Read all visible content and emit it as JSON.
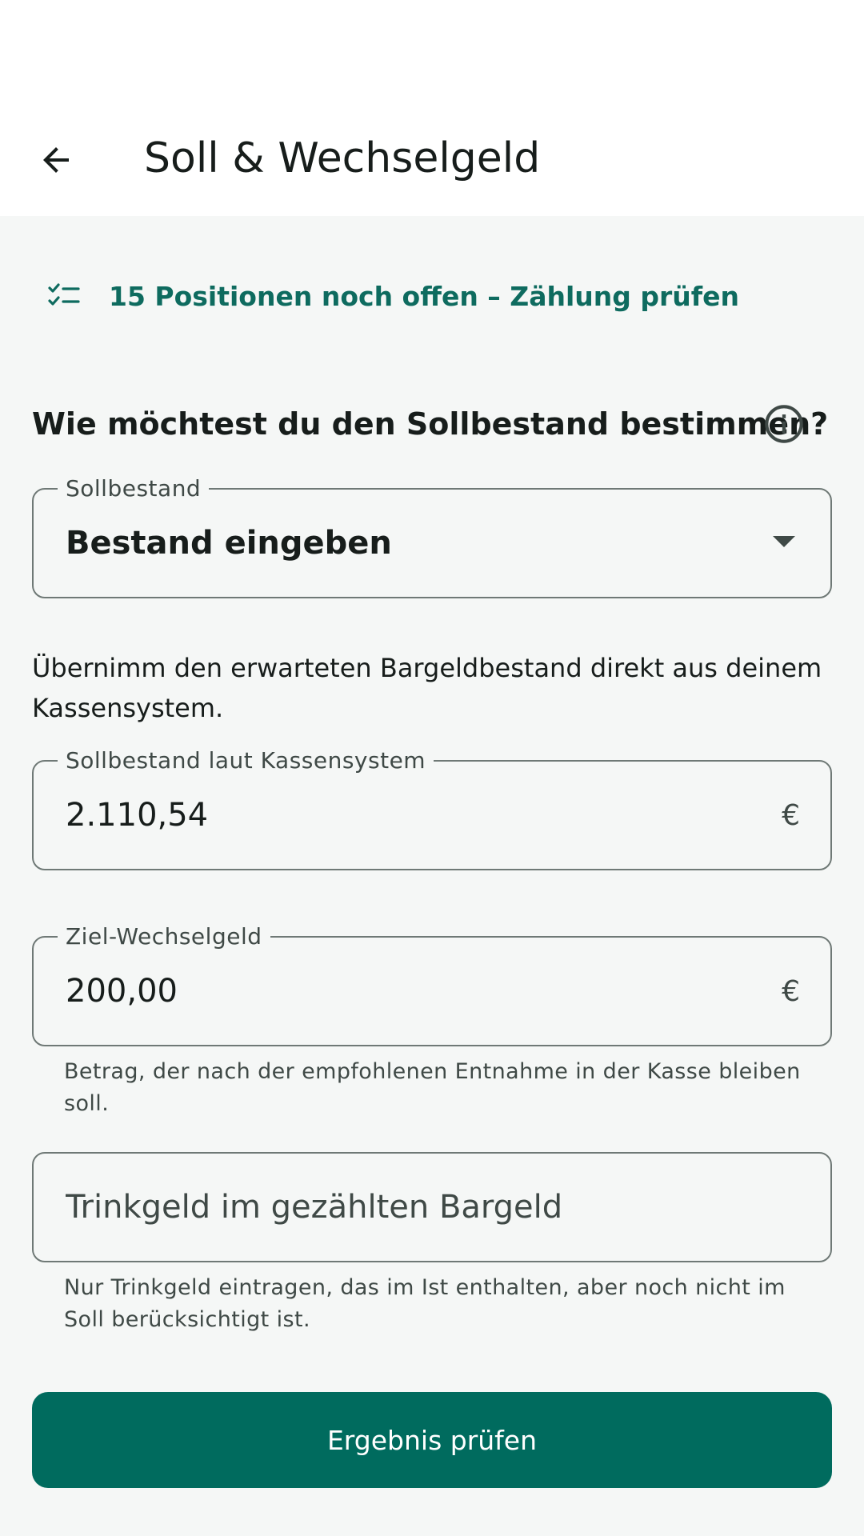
{
  "app_bar": {
    "title": "Soll & Wechselgeld",
    "back_icon": "arrow-left-icon"
  },
  "open_hint": {
    "icon": "checklist-icon",
    "label": "15 Positionen noch offen – Zählung prüfen"
  },
  "question": {
    "text": "Wie möchtest du den Sollbestand bestimmen?",
    "info_icon": "info-icon"
  },
  "sollbestand_select": {
    "label": "Sollbestand",
    "value": "Bestand eingeben"
  },
  "description": "Übernimm den erwarteten Bargeldbestand direkt aus deinem Kassensystem.",
  "kassensystem_field": {
    "label": "Sollbestand laut Kassensystem",
    "value": "2.110,54",
    "suffix": "€"
  },
  "wechselgeld_field": {
    "label": "Ziel-Wechselgeld",
    "value": "200,00",
    "suffix": "€",
    "supporting_text": "Betrag, der nach der empfohlenen Entnahme in der Kasse bleiben soll."
  },
  "trinkgeld_field": {
    "placeholder": "Trinkgeld im gezählten Bargeld",
    "supporting_text": "Nur Trinkgeld eintragen, das im Ist enthalten, aber noch nicht im Soll berücksichtigt ist."
  },
  "submit_button": {
    "label": "Ergebnis prüfen"
  },
  "colors": {
    "primary": "#006b5e",
    "primary_text": "#0e6b5f",
    "background": "#f5f7f6",
    "surface": "#ffffff",
    "outline": "#6f7976"
  }
}
